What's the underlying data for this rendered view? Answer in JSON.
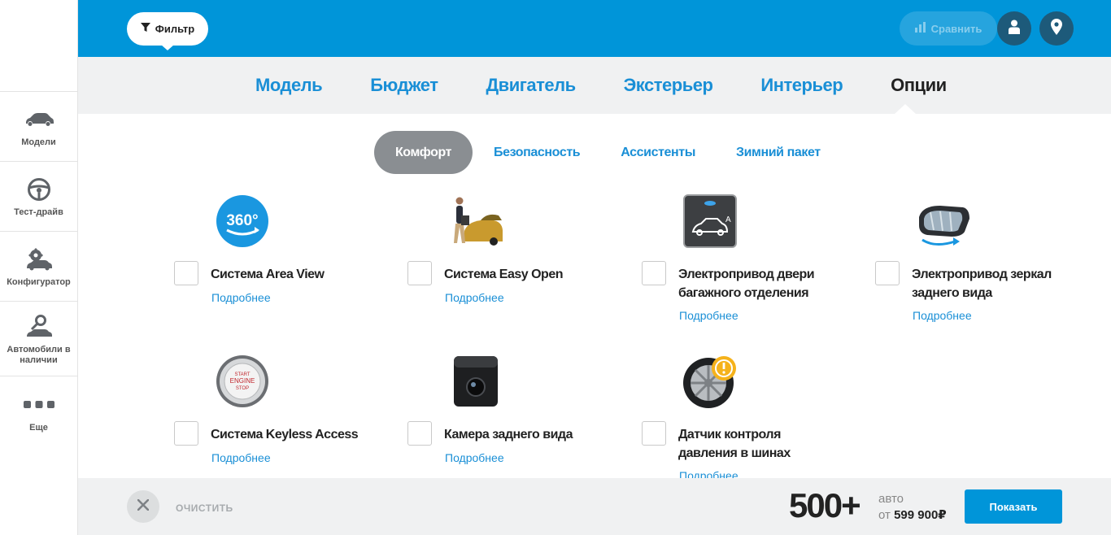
{
  "sidebar": {
    "items": [
      {
        "label": "Модели",
        "icon": "car-icon"
      },
      {
        "label": "Тест-драйв",
        "icon": "steering-wheel-icon"
      },
      {
        "label": "Конфигуратор",
        "icon": "gear-car-icon"
      },
      {
        "label": "Автомобили в наличии",
        "icon": "key-car-icon"
      },
      {
        "label": "Еще",
        "icon": "more-dots-icon"
      }
    ]
  },
  "topbar": {
    "filter_label": "Фильтр",
    "compare_label": "Сравнить"
  },
  "categories": {
    "tabs": [
      {
        "label": "Модель"
      },
      {
        "label": "Бюджет"
      },
      {
        "label": "Двигатель"
      },
      {
        "label": "Экстерьер"
      },
      {
        "label": "Интерьер"
      },
      {
        "label": "Опции",
        "active": true
      }
    ]
  },
  "subtabs": [
    {
      "label": "Комфорт",
      "active": true
    },
    {
      "label": "Безопасность"
    },
    {
      "label": "Ассистенты"
    },
    {
      "label": "Зимний пакет"
    }
  ],
  "options": {
    "more_label": "Подробнее",
    "items": [
      {
        "name": "Система Area View",
        "icon": "camera-360-icon"
      },
      {
        "name": "Система Easy Open",
        "icon": "easy-open-photo"
      },
      {
        "name": "Электропривод двери багажного отделения",
        "line1": "Электропривод двери",
        "line2": "багажного отделения",
        "icon": "power-tailgate-icon"
      },
      {
        "name": "Электропривод зеркал заднего вида",
        "line1": "Электропривод зеркал",
        "line2": "заднего вида",
        "icon": "power-mirror-icon"
      },
      {
        "name": "Система Keyless Access",
        "icon": "start-engine-button-icon"
      },
      {
        "name": "Камера заднего вида",
        "icon": "rear-camera-icon"
      },
      {
        "name": "Датчик контроля давления в шинах",
        "line1": "Датчик контроля",
        "line2": "давления в шинах",
        "icon": "tire-pressure-icon"
      }
    ]
  },
  "bottombar": {
    "clear_label": "ОЧИСТИТЬ",
    "count": "500+",
    "count_unit": "авто",
    "price_prefix": "от",
    "price": "599 900₽",
    "show_label": "Показать"
  },
  "colors": {
    "brand_blue": "#0095d9",
    "link_blue": "#1a8fd6",
    "dark_circle": "#1d5a7a",
    "active_subtab": "#8a8e92"
  }
}
